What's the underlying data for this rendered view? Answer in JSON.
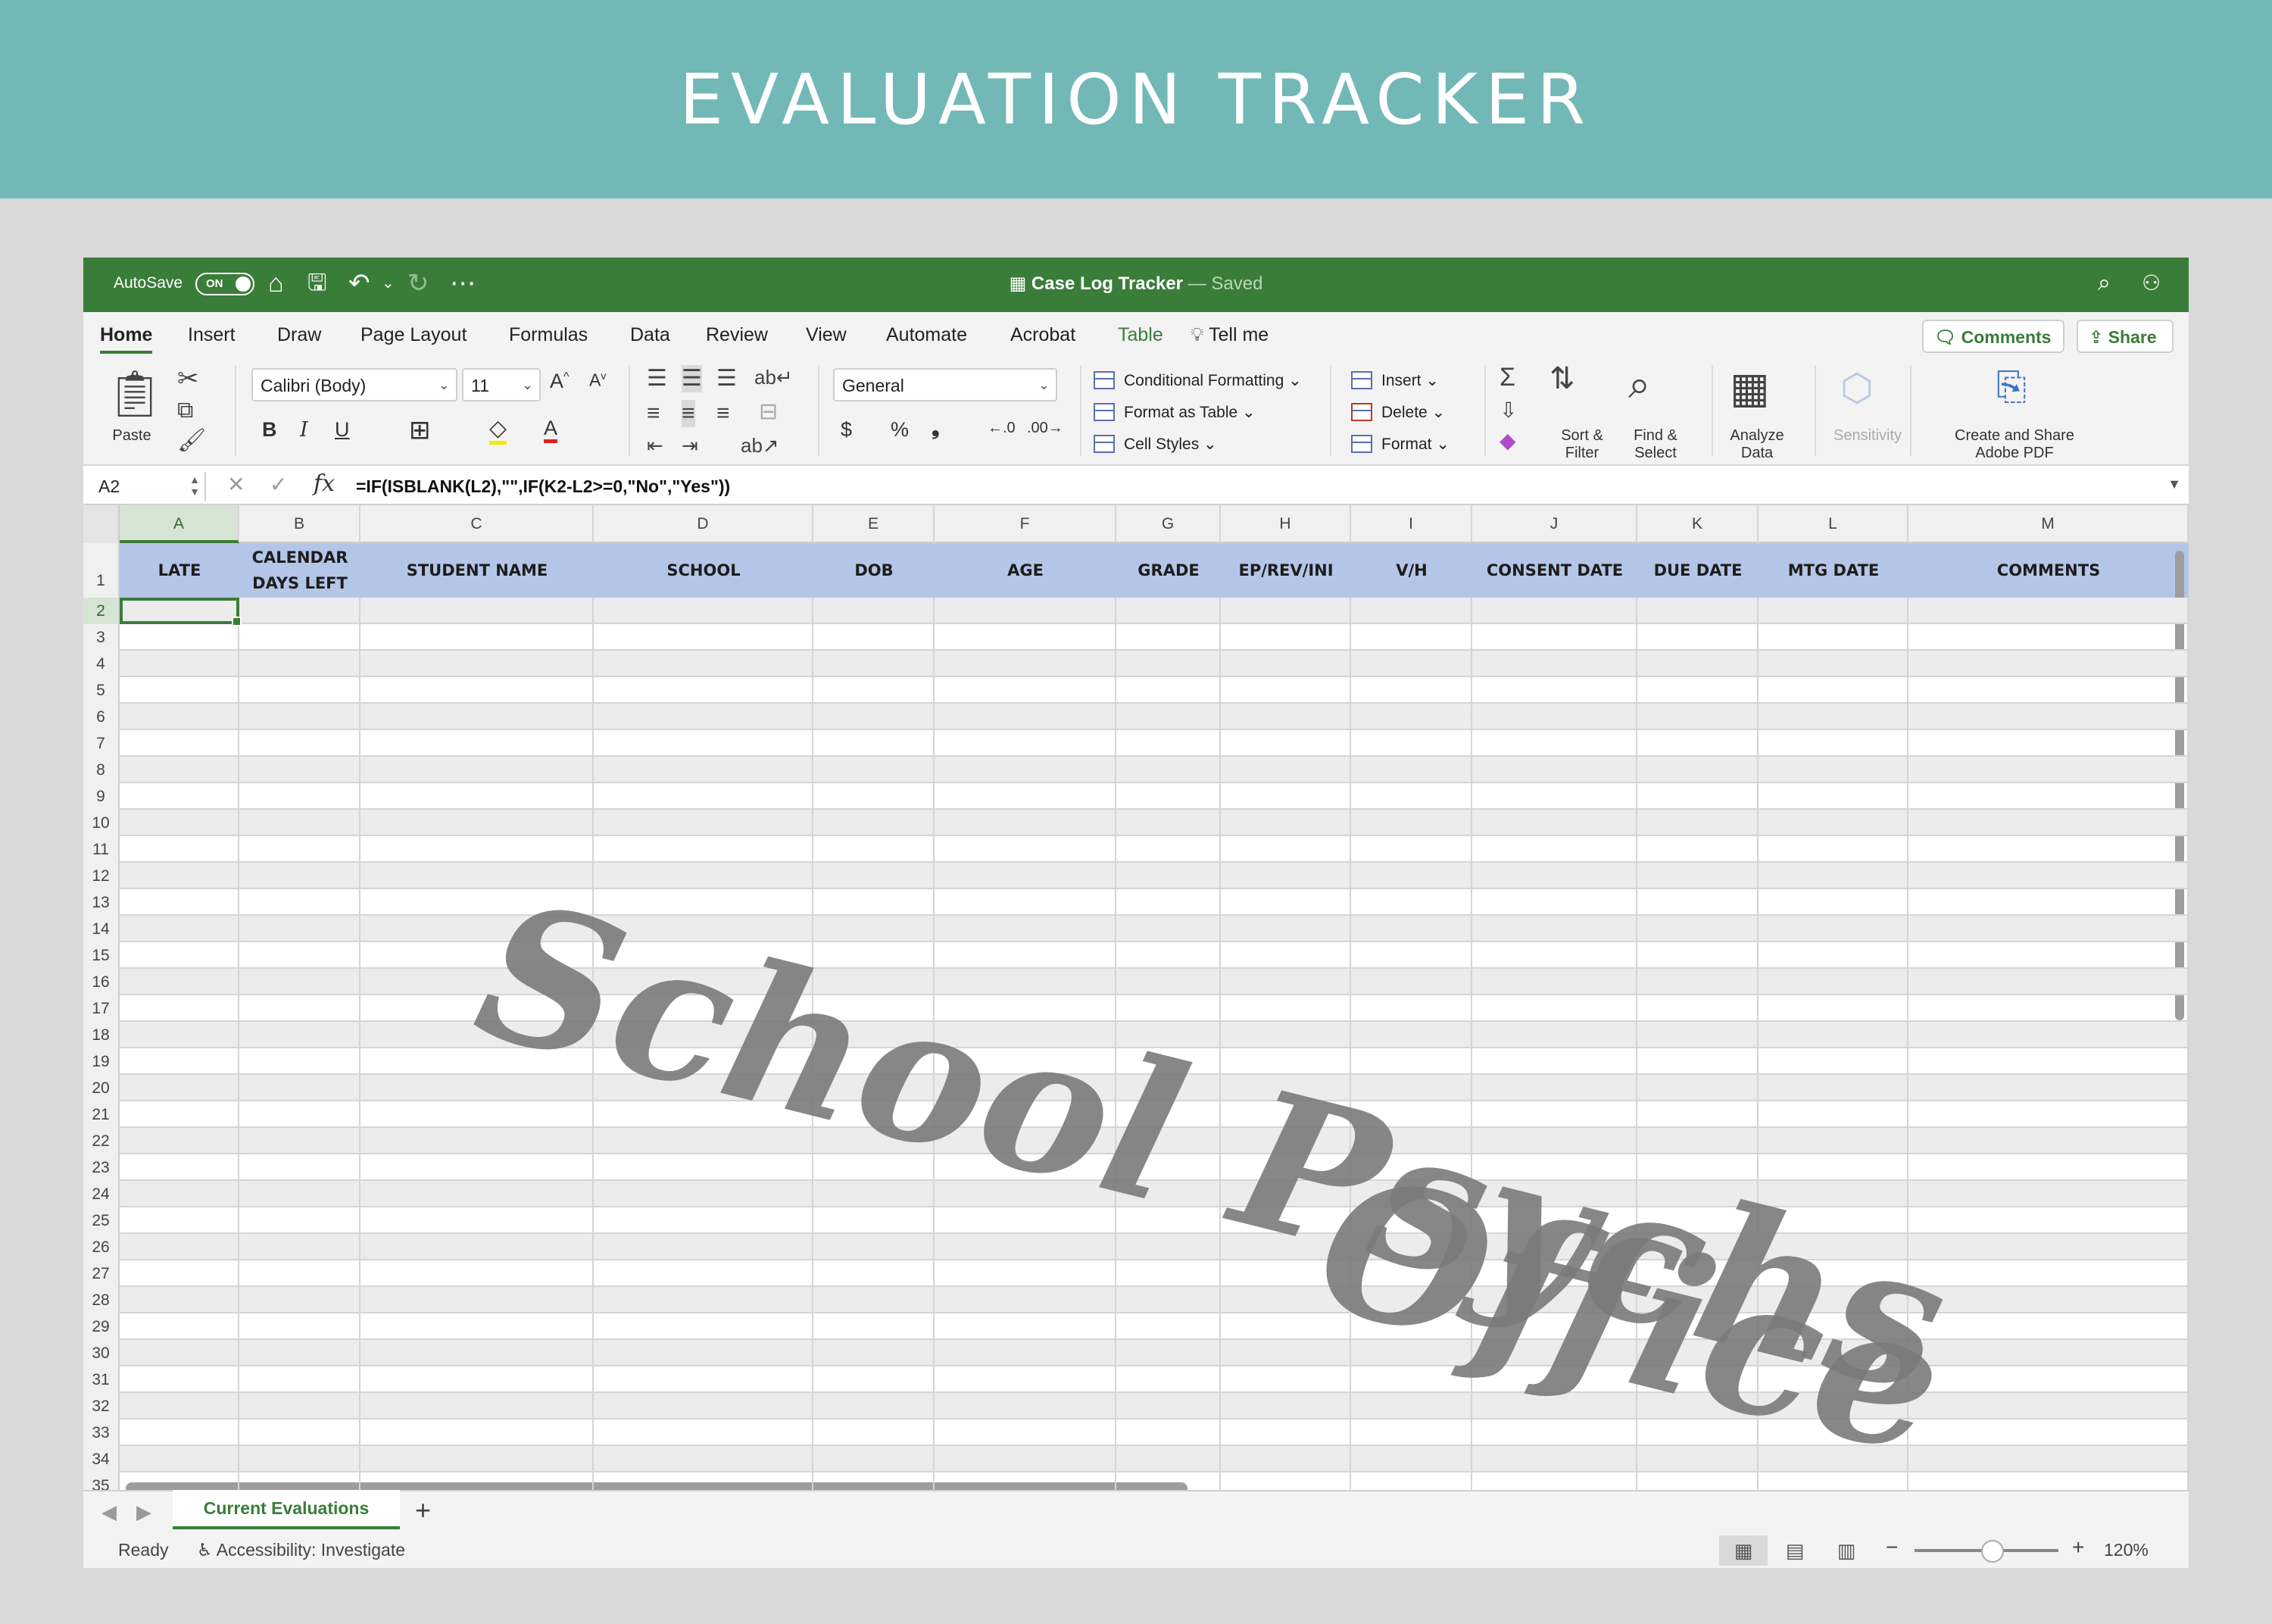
{
  "banner": {
    "title": "EVALUATION TRACKER"
  },
  "titlebar": {
    "autosave_label": "AutoSave",
    "autosave_state": "ON",
    "doc_title": "Case Log Tracker",
    "saved_status": "— Saved"
  },
  "menu": {
    "tabs": [
      "Home",
      "Insert",
      "Draw",
      "Page Layout",
      "Formulas",
      "Data",
      "Review",
      "View",
      "Automate",
      "Acrobat",
      "Table"
    ],
    "tell_me": "Tell me",
    "comments_label": "Comments",
    "share_label": "Share"
  },
  "ribbon": {
    "paste_label": "Paste",
    "font_name": "Calibri (Body)",
    "font_size": "11",
    "number_format": "General",
    "conditional_formatting": "Conditional Formatting",
    "format_as_table": "Format as Table",
    "cell_styles": "Cell Styles",
    "insert": "Insert",
    "delete": "Delete",
    "format": "Format",
    "sort_filter_1": "Sort &",
    "sort_filter_2": "Filter",
    "find_select_1": "Find &",
    "find_select_2": "Select",
    "analyze_1": "Analyze",
    "analyze_2": "Data",
    "sensitivity": "Sensitivity",
    "adobe_1": "Create and Share",
    "adobe_2": "Adobe PDF"
  },
  "formula_bar": {
    "name_box": "A2",
    "fx": "fx",
    "formula": "=IF(ISBLANK(L2),\"\",IF(K2-L2>=0,\"No\",\"Yes\"))"
  },
  "sheet": {
    "columns": [
      "A",
      "B",
      "C",
      "D",
      "E",
      "F",
      "G",
      "H",
      "I",
      "J",
      "K",
      "L",
      "M"
    ],
    "headers": [
      "LATE",
      "CALENDAR DAYS LEFT",
      "STUDENT NAME",
      "SCHOOL",
      "DOB",
      "AGE",
      "GRADE",
      "EP/REV/INI",
      "V/H",
      "CONSENT DATE",
      "DUE DATE",
      "MTG DATE",
      "COMMENTS"
    ],
    "rows": [
      "1",
      "2",
      "3",
      "4",
      "5",
      "6",
      "7",
      "8",
      "9",
      "10",
      "11",
      "12",
      "13",
      "14",
      "15",
      "16",
      "17",
      "18",
      "19",
      "20",
      "21",
      "22",
      "23",
      "24",
      "25",
      "26",
      "27",
      "28",
      "29",
      "30",
      "31",
      "32",
      "33",
      "34",
      "35"
    ],
    "selected_column": "A",
    "selected_row": "2"
  },
  "watermark": {
    "line1": "School Psychs",
    "line2": "Office"
  },
  "sheet_tabs": {
    "active": "Current Evaluations",
    "add": "+"
  },
  "status": {
    "ready": "Ready",
    "accessibility": "Accessibility: Investigate",
    "zoom_minus": "−",
    "zoom_plus": "+",
    "zoom": "120%"
  },
  "colors": {
    "banner": "#72b8b7",
    "excel_green": "#3a7d39",
    "header_blue": "#b4c6e7",
    "watermark": "#7a7a7a"
  }
}
